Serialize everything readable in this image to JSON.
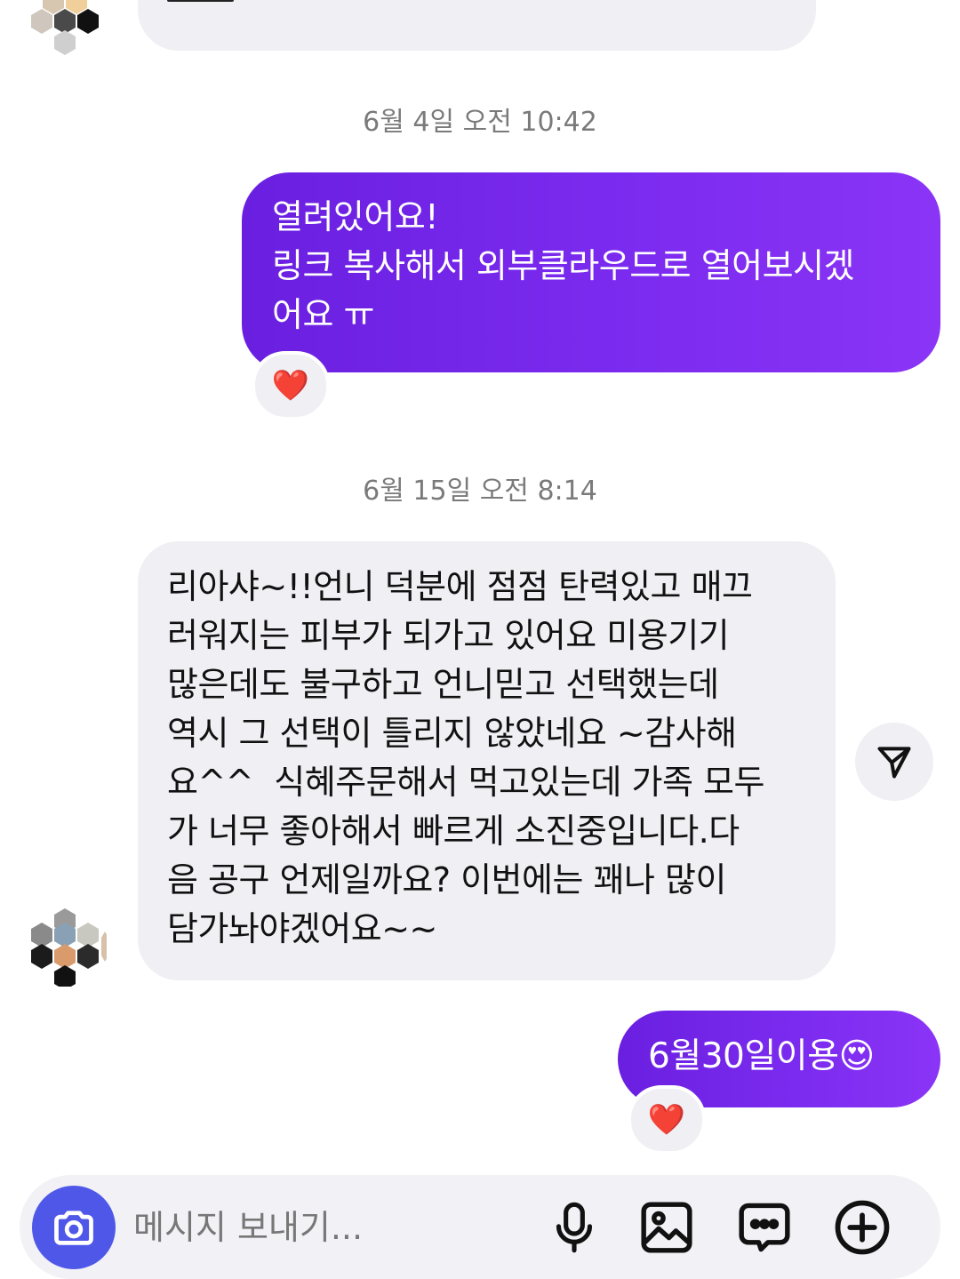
{
  "messages": [
    {
      "id": "partial-top",
      "direction": "incoming",
      "text": ""
    },
    {
      "id": "msg-1",
      "direction": "outgoing",
      "timestamp": "6월 4일 오전 10:42",
      "text": "열려있어요!\n링크 복사해서 외부클라우드로 열어보시겠\n어요 ㅠ",
      "reaction": "❤️"
    },
    {
      "id": "msg-2",
      "direction": "incoming",
      "timestamp": "6월 15일 오전 8:14",
      "text": "리아샤~!!언니 덕분에 점점 탄력있고 매끄\n러워지는 피부가 되가고 있어요 미용기기\n많은데도 불구하고 언니믿고 선택했는데\n역시 그 선택이 틀리지 않았네요 ~감사해\n요^^  식혜주문해서 먹고있는데 가족 모두\n가 너무 좋아해서 빠르게 소진중입니다.다\n음 공구 언제일까요? 이번에는 꽤나 많이\n담가놔야겠어요~~"
    },
    {
      "id": "msg-3",
      "direction": "outgoing",
      "text": "6월30일이용😍",
      "reaction": "❤️"
    }
  ],
  "composer": {
    "placeholder": "메시지 보내기..."
  },
  "icons": {
    "camera": "camera-icon",
    "microphone": "microphone-icon",
    "gallery": "image-icon",
    "sticker": "chat-bubble-icon",
    "more": "plus-circle-icon",
    "share": "send-icon",
    "heart": "heart-icon"
  },
  "colors": {
    "outgoing_bubble": "#7b2bef",
    "incoming_bubble": "#efeff4",
    "camera_button": "#4f57e8",
    "timestamp": "#7a7a7a"
  }
}
